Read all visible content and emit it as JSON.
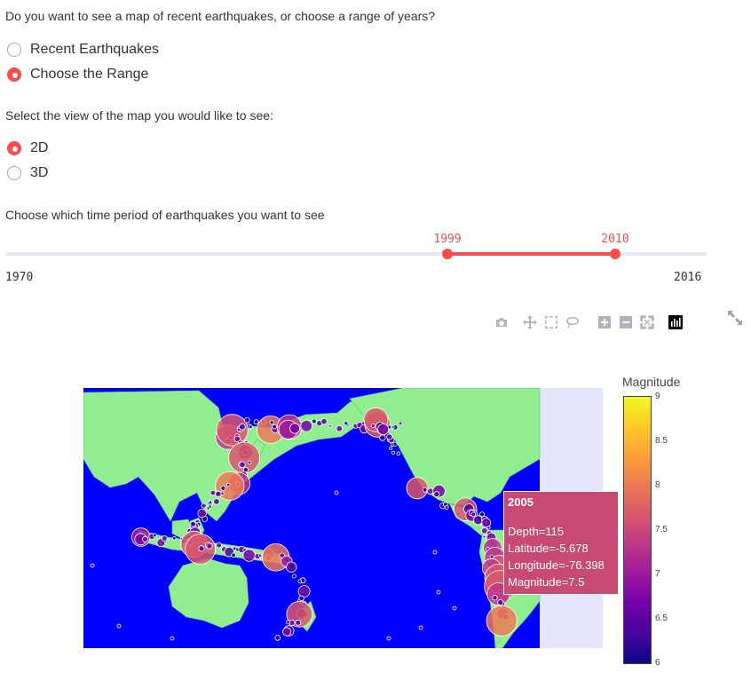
{
  "question1": {
    "text": "Do you want to see a map of recent earthquakes, or choose a range of years?",
    "options": [
      "Recent Earthquakes",
      "Choose the Range"
    ],
    "selected": 1
  },
  "question2": {
    "text": "Select the view of the map you would like to see:",
    "options": [
      "2D",
      "3D"
    ],
    "selected": 0
  },
  "slider": {
    "label": "Choose which time period of earthquakes you want to see",
    "min": 1970,
    "max": 2016,
    "low": 1999,
    "high": 2010,
    "min_label": "1970",
    "max_label": "2016",
    "low_label": "1999",
    "high_label": "2010"
  },
  "modebar": {
    "icons": [
      "camera-icon",
      "pan-icon",
      "box-select-icon",
      "lasso-icon",
      "zoom-in-icon",
      "zoom-out-icon",
      "autoscale-icon",
      "plotly-logo-icon"
    ]
  },
  "expand_icon": "fullscreen-icon",
  "colorbar": {
    "title": "Magnitude",
    "ticks": [
      "9",
      "8.5",
      "8",
      "7.5",
      "7",
      "6.5",
      "6"
    ],
    "colorscale": [
      "#0d0887",
      "#46039f",
      "#7201a8",
      "#9c179e",
      "#bd3786",
      "#d8576b",
      "#ed7953",
      "#fb9f3a",
      "#fdca26",
      "#f0f921"
    ]
  },
  "map": {
    "ocean_color": "#0000ff",
    "land_color": "#90ee90",
    "background_color": "#e5e5fb"
  },
  "tooltip": {
    "year": "2005",
    "lines": [
      "Depth=115",
      "Latitude=-5.678",
      "Longitude=-76.398",
      "Magnitude=7.5"
    ],
    "color": "#c84a72"
  }
}
